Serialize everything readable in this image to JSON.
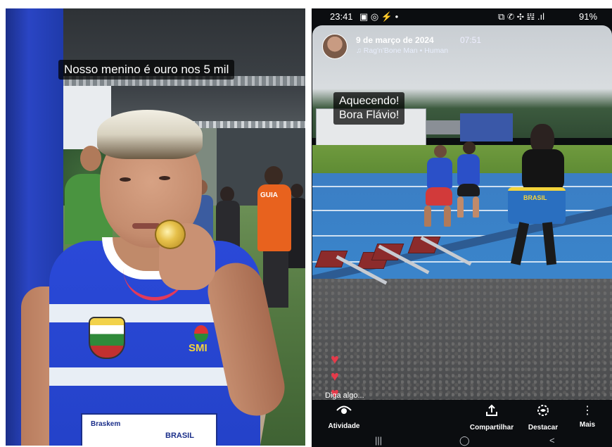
{
  "left_story": {
    "caption": "Nosso menino é ouro nos 5 mil",
    "guide_vest_text": "GUIA",
    "bib_sponsor": "Braskem",
    "bib_brand": "BRASIL",
    "shirt_text": "SMI"
  },
  "right_story": {
    "status_bar": {
      "time": "23:41",
      "left_icons": "▣ ◎ ⚡ •",
      "right_icons": "⧉ ✆ ✣ 𝍒 .ıl",
      "battery": "91%"
    },
    "header": {
      "date": "9 de março de 2024",
      "time": "07:51",
      "music": "♫ Rag'n'Bone Man • Human"
    },
    "caption_line1": "Aquecendo!",
    "caption_line2": "Bora Flávio!",
    "flag_text": "BRASIL",
    "comment_placeholder": "Diga algo...",
    "toolbar": {
      "activity": {
        "icon": "eye-icon",
        "label": "Atividade"
      },
      "share": {
        "icon": "share-icon",
        "label": "Compartilhar"
      },
      "highlight": {
        "icon": "highlight-icon",
        "label": "Destacar"
      },
      "more": {
        "icon": "more-icon",
        "label": "Mais"
      }
    },
    "nav_bar": {
      "recents": "|||",
      "home": "◯",
      "back": "<"
    }
  }
}
